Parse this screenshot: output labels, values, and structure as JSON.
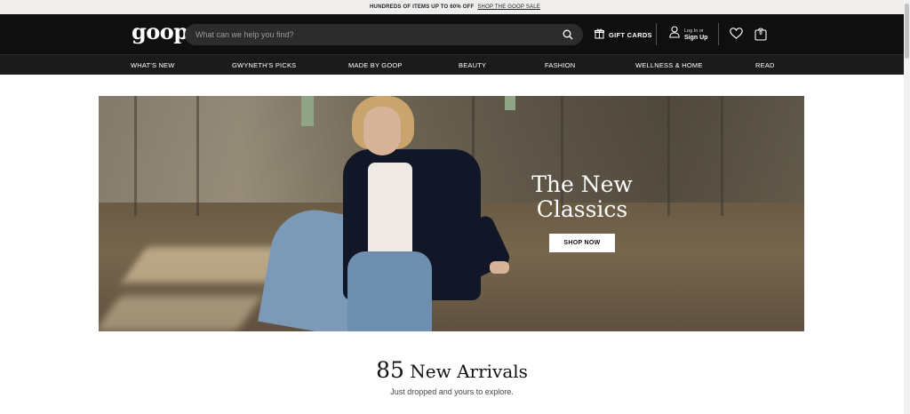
{
  "promo": {
    "text": "HUNDREDS OF ITEMS UP TO 60% OFF",
    "link": "SHOP THE GOOP SALE"
  },
  "header": {
    "logo": "goop",
    "search_placeholder": "What can we help you find?",
    "gift_cards": "GIFT CARDS",
    "login_small": "Log In or",
    "login_big": "Sign Up",
    "bag_count": "0"
  },
  "nav": {
    "items": [
      "WHAT'S NEW",
      "GWYNETH'S PICKS",
      "MADE BY GOOP",
      "BEAUTY",
      "FASHION",
      "WELLNESS & HOME",
      "READ"
    ]
  },
  "hero": {
    "headline_line1": "The New",
    "headline_line2": "Classics",
    "button": "SHOP NOW"
  },
  "arrivals": {
    "count": "85",
    "title": "New Arrivals",
    "subtitle": "Just dropped and yours to explore."
  },
  "colors": {
    "header_bg": "#0f0f0f",
    "nav_bg": "#1b1b1b",
    "promo_bg": "#efeeec"
  }
}
